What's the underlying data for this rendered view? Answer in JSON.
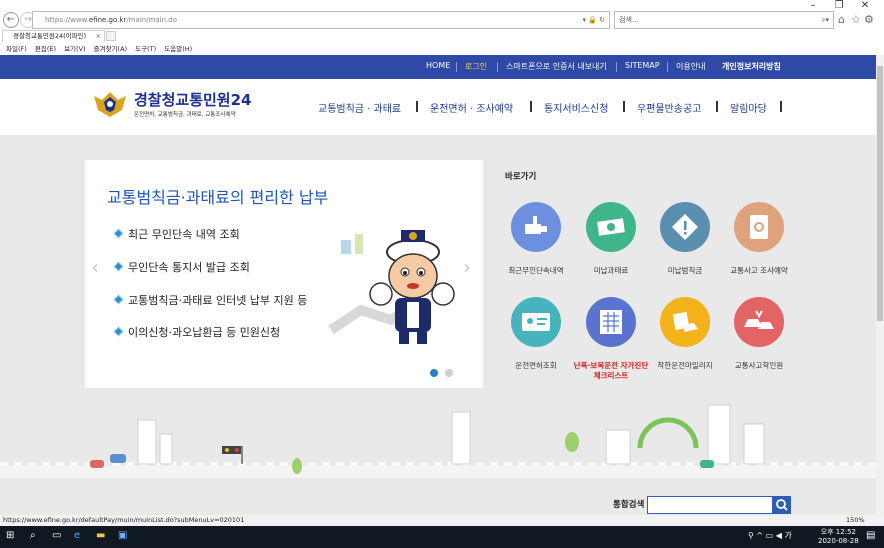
{
  "browser": {
    "url_prefix": "https://www.",
    "url_host": "efine.go.kr",
    "url_path": "/main/main.do",
    "search_placeholder": "검색...",
    "tab_title": "경찰청교통민원24(이파인)",
    "menu": [
      "파일(F)",
      "편집(E)",
      "보기(V)",
      "즐겨찾기(A)",
      "도구(T)",
      "도움말(H)"
    ],
    "status_url": "https://www.efine.go.kr/defaultPay/muin/muinList.do?subMenuLv=020101",
    "zoom": "150%"
  },
  "topnav": {
    "home": "HOME",
    "login": "로그인",
    "smartphone": "스마트폰으로 인증서 내보내기",
    "sitemap": "SITEMAP",
    "guide": "이용안내",
    "privacy": "개인정보처리방침"
  },
  "logo": {
    "title_a": "경찰청",
    "title_b": "교통민원24",
    "subtitle": "운전면허, 교통범칙금, 과태료, 교통조사예약"
  },
  "gnb": [
    "교통범칙금 · 과태료",
    "운전면허 · 조사예약",
    "통지서비스신청",
    "우편물반송공고",
    "알림마당"
  ],
  "banner": {
    "title": "교통범칙금·과태료의 편리한 납부",
    "items": [
      "최근 무인단속 내역 조회",
      "무인단속 통지서 발급 조회",
      "교통범칙금·과태료 인터넷 납부 지원 등",
      "이의신청·과오납환급 등 민원신청"
    ]
  },
  "quick": {
    "title": "바로가기",
    "items": [
      {
        "label": "최근무인단속내역",
        "icon": "camera-icon",
        "color": "#6d8fe0"
      },
      {
        "label": "미납과태료",
        "icon": "money-icon",
        "color": "#3fb58a"
      },
      {
        "label": "미납범칙금",
        "icon": "warning-icon",
        "color": "#5a8fb0"
      },
      {
        "label": "교통사고 조사예약",
        "icon": "tablet-icon",
        "color": "#e0a27c"
      },
      {
        "label": "운전면허조회",
        "icon": "id-card-icon",
        "color": "#47b3bd"
      },
      {
        "label": "난폭·보복운전 자가진단 체크리스트",
        "icon": "checklist-icon",
        "color": "#5a73cf"
      },
      {
        "label": "착한운전마일리지",
        "icon": "mileage-icon",
        "color": "#f4b21b"
      },
      {
        "label": "교통사고학인원",
        "icon": "car-crash-icon",
        "color": "#e36464"
      }
    ]
  },
  "search": {
    "label": "통합검색"
  },
  "taskbar": {
    "time": "오후 12:52",
    "date": "2020-08-28"
  }
}
